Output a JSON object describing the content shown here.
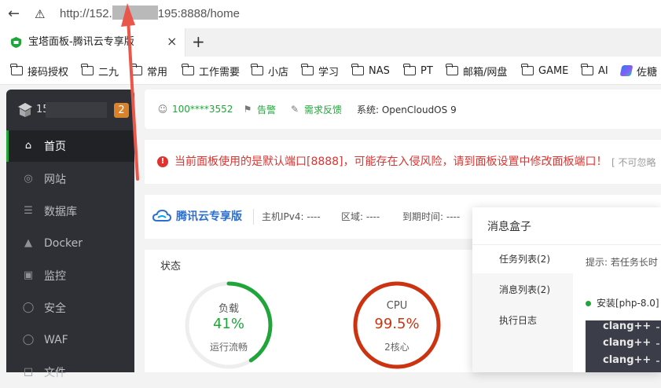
{
  "browser": {
    "url_prefix": "http://152.",
    "url_suffix": "195:8888/home",
    "tab_title": "宝塔面板-腾讯云专享版",
    "bookmarks": [
      "接码授权",
      "二九",
      "常用",
      "工作需要",
      "小店",
      "学习",
      "NAS",
      "PT",
      "邮箱/网盘",
      "GAME",
      "AI",
      "佐糖"
    ]
  },
  "sidebar": {
    "server_name": "15",
    "badge": "2",
    "items": [
      {
        "label": "首页",
        "icon": "home-icon"
      },
      {
        "label": "网站",
        "icon": "globe-icon"
      },
      {
        "label": "数据库",
        "icon": "database-icon"
      },
      {
        "label": "Docker",
        "icon": "docker-icon"
      },
      {
        "label": "监控",
        "icon": "monitor-icon"
      },
      {
        "label": "安全",
        "icon": "shield-icon"
      },
      {
        "label": "WAF",
        "icon": "shield-icon"
      },
      {
        "label": "文件",
        "icon": "folder-icon"
      }
    ]
  },
  "infobar": {
    "user": "100****3552",
    "alarm": "告警",
    "feedback": "需求反馈",
    "system": "系统: OpenCloudOS 9"
  },
  "alert": {
    "text": "当前面板使用的是默认端口[8888]，可能存在入侵风险，请到面板设置中修改面板端口！",
    "ignore": "[ 不可忽略"
  },
  "cloud": {
    "title": "腾讯云专享版",
    "ipv4": "主机IPv4:  ----",
    "region": "区域:  ----",
    "expire": "到期时间:  ----"
  },
  "status": {
    "title": "状态",
    "gauges": [
      {
        "label": "负载",
        "value": "41%",
        "sub": "运行流畅",
        "fraction": 0.41,
        "color": "#20a53a"
      },
      {
        "label": "CPU",
        "value": "99.5%",
        "sub": "2核心",
        "fraction": 0.995,
        "color": "#cc3311"
      }
    ]
  },
  "dialog": {
    "title": "消息盒子",
    "tabs": [
      "任务列表(2)",
      "消息列表(2)",
      "执行日志"
    ],
    "hint": "提示: 若任务长时",
    "installing": "安装[php-8.0]",
    "console_lines": [
      "clang++",
      "clang++",
      "clang++"
    ]
  },
  "colors": {
    "sidebar_bg": "#2e3035",
    "accent_green": "#20a53a",
    "alert_red": "#e0322f",
    "tencent_blue": "#2c6fd1",
    "annotation_arrow": "#e8574a"
  }
}
